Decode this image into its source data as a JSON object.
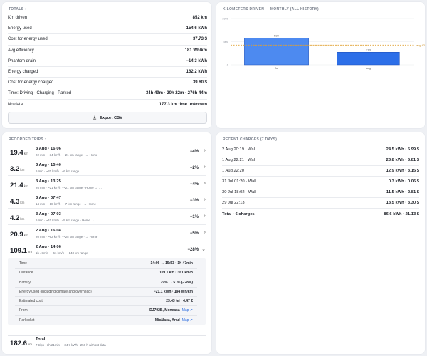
{
  "totals": {
    "title": "TOTALS",
    "rows": [
      {
        "label": "Km driven",
        "value": "852 km"
      },
      {
        "label": "Energy used",
        "value": "154.6 kWh"
      },
      {
        "label": "Cost for energy used",
        "value": "37.73 $"
      },
      {
        "label": "Avg efficiency",
        "value": "181 Wh/km"
      },
      {
        "label": "Phantom drain",
        "value": "−14.3 kWh"
      },
      {
        "label": "Energy charged",
        "value": "162.2 kWh"
      },
      {
        "label": "Cost for energy charged",
        "value": "39.60 $"
      },
      {
        "label": "Time: Driving · Charging · Parked",
        "value": "34h 49m · 20h 22m · 276h 44m"
      },
      {
        "label": "No data",
        "value": "177.3 km time unknown"
      }
    ],
    "export_label": "Export CSV"
  },
  "km_chart": {
    "title": "KILOMETERS DRIVEN — MONTHLY (ALL HISTORY)",
    "avg_label": "avg 426",
    "chart_data": {
      "type": "bar",
      "categories": [
        "Jul",
        "Aug"
      ],
      "values": [
        580,
        273
      ],
      "value_labels": [
        "580",
        "273"
      ],
      "yticks": [
        0,
        500,
        1000
      ],
      "ylim": [
        0,
        1000
      ],
      "average": 426,
      "colors": [
        "#4d8af0",
        "#2d6fe8"
      ]
    }
  },
  "trips": {
    "title": "RECORDED TRIPS",
    "unit": "km",
    "items": [
      {
        "dist": "19.4",
        "when": "3 Aug · 16:06",
        "sub": "22 min · ~34 km/h · ~21 km range · → Home",
        "pct": "−4%"
      },
      {
        "dist": "3.2",
        "when": "3 Aug · 15:40",
        "sub": "6 min · ~31 km/h · ~6 km range",
        "pct": "−2%"
      },
      {
        "dist": "21.4",
        "when": "3 Aug · 13:25",
        "sub": "26 min · ~21 km/h · ~21 km range · Home → …",
        "pct": "−4%"
      },
      {
        "dist": "4.3",
        "when": "3 Aug · 07:47",
        "sub": "14 min · ~18 km/h · ~7 km range · → Home",
        "pct": "−3%"
      },
      {
        "dist": "4.2",
        "when": "3 Aug · 07:03",
        "sub": "6 min · ~41 km/h · ~5 km range · Home → …",
        "pct": "−1%"
      },
      {
        "dist": "20.9",
        "when": "2 Aug · 16:04",
        "sub": "20 min · ~62 km/h · ~25 km range · → Home",
        "pct": "−5%"
      },
      {
        "dist": "109.1",
        "when": "2 Aug · 14:06",
        "sub": "1h 47min · ~61 km/h · ~143 km range",
        "pct": "−28%"
      }
    ],
    "details": [
      {
        "label": "Time",
        "value": "14:06 → 15:53 · 1h 47min"
      },
      {
        "label": "Distance",
        "value": "109.1 km · ~61 km/h"
      },
      {
        "label": "Battery",
        "value": "79% → 51% (−28%)"
      },
      {
        "label": "Energy used (including climate and overhead)",
        "value": "~21.1 kWh · 194 Wh/km"
      },
      {
        "label": "Estimated cost",
        "value": "23.43 lei · 4.47 €"
      },
      {
        "label": "From",
        "value": "DJ792B, Moneasa",
        "map": "Map ↗"
      },
      {
        "label": "Parked at",
        "value": "Micălaca, Arad",
        "map": "Map ↗"
      }
    ],
    "total": {
      "dist": "182.6",
      "label": "Total",
      "sub": "7 trips · 3h 21min · ~34.7 kWh · 256 h without data"
    }
  },
  "charges": {
    "title": "RECENT CHARGES (7 DAYS)",
    "items": [
      {
        "label": "2 Aug 20:19 · Wall",
        "value": "24.5 kWh · 5.99 $"
      },
      {
        "label": "1 Aug 22:21 · Wall",
        "value": "23.8 kWh · 5.81 $"
      },
      {
        "label": "1 Aug 22:20",
        "value": "12.9 kWh · 3.15 $"
      },
      {
        "label": "31 Jul 01:20 · Wall",
        "value": "0.3 kWh · 0.06 $"
      },
      {
        "label": "30 Jul 18:02 · Wall",
        "value": "11.5 kWh · 2.81 $"
      },
      {
        "label": "29 Jul 22:13",
        "value": "13.5 kWh · 3.30 $"
      }
    ],
    "total_label": "Total · 6 charges",
    "total_value": "86.6 kWh · 21.13 $"
  }
}
